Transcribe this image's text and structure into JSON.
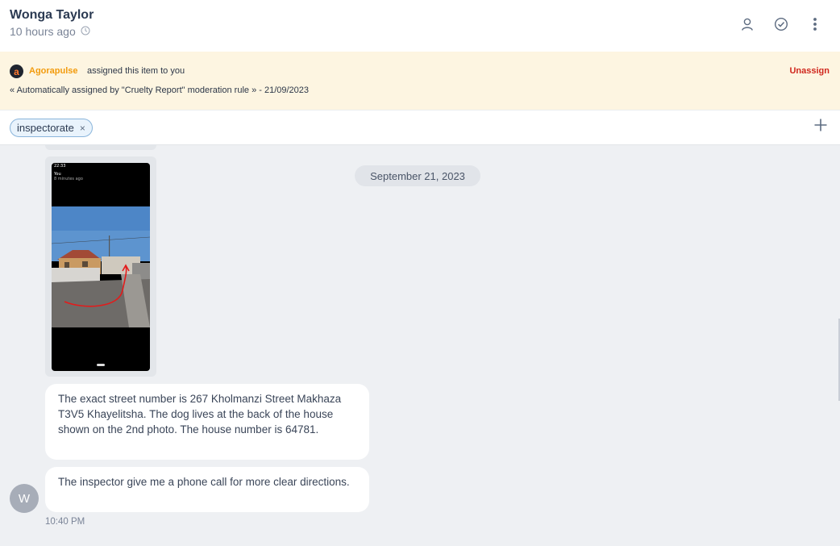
{
  "header": {
    "contact_name": "Wonga Taylor",
    "time_ago": "10 hours ago",
    "icons": [
      "clock-icon",
      "assign-user-icon",
      "check-circle-icon",
      "more-vertical-icon"
    ]
  },
  "assignment": {
    "brand_initial": "a",
    "brand_name": "Agorapulse",
    "assigned_text": "assigned this item to you",
    "auto_text": "« Automatically assigned by \"Cruelty Report\" moderation rule » - 21/09/2023",
    "unassign_label": "Unassign",
    "colors": {
      "brand": "#f29b0d",
      "unassign": "#d0271d",
      "banner_bg": "#fdf5e1"
    }
  },
  "tags": {
    "items": [
      {
        "label": "inspectorate",
        "remove_icon": "×"
      }
    ],
    "add_icon": "plus-icon"
  },
  "phone_screenshot": {
    "status_time": "22:33",
    "toolbar_title": "You",
    "toolbar_subtitle": "8 minutes ago"
  },
  "thread": {
    "date_separator": "September 21, 2023",
    "messages": [
      {
        "text": "The exact street number is 267 Kholmanzi Street Makhaza T3V5 Khayelitsha. The dog lives at the back of the house shown on the 2nd photo. The house number is 64781."
      },
      {
        "text": "The inspector give me a phone call for more clear directions."
      }
    ],
    "avatar_initial": "W",
    "timestamp": "10:40 PM"
  }
}
